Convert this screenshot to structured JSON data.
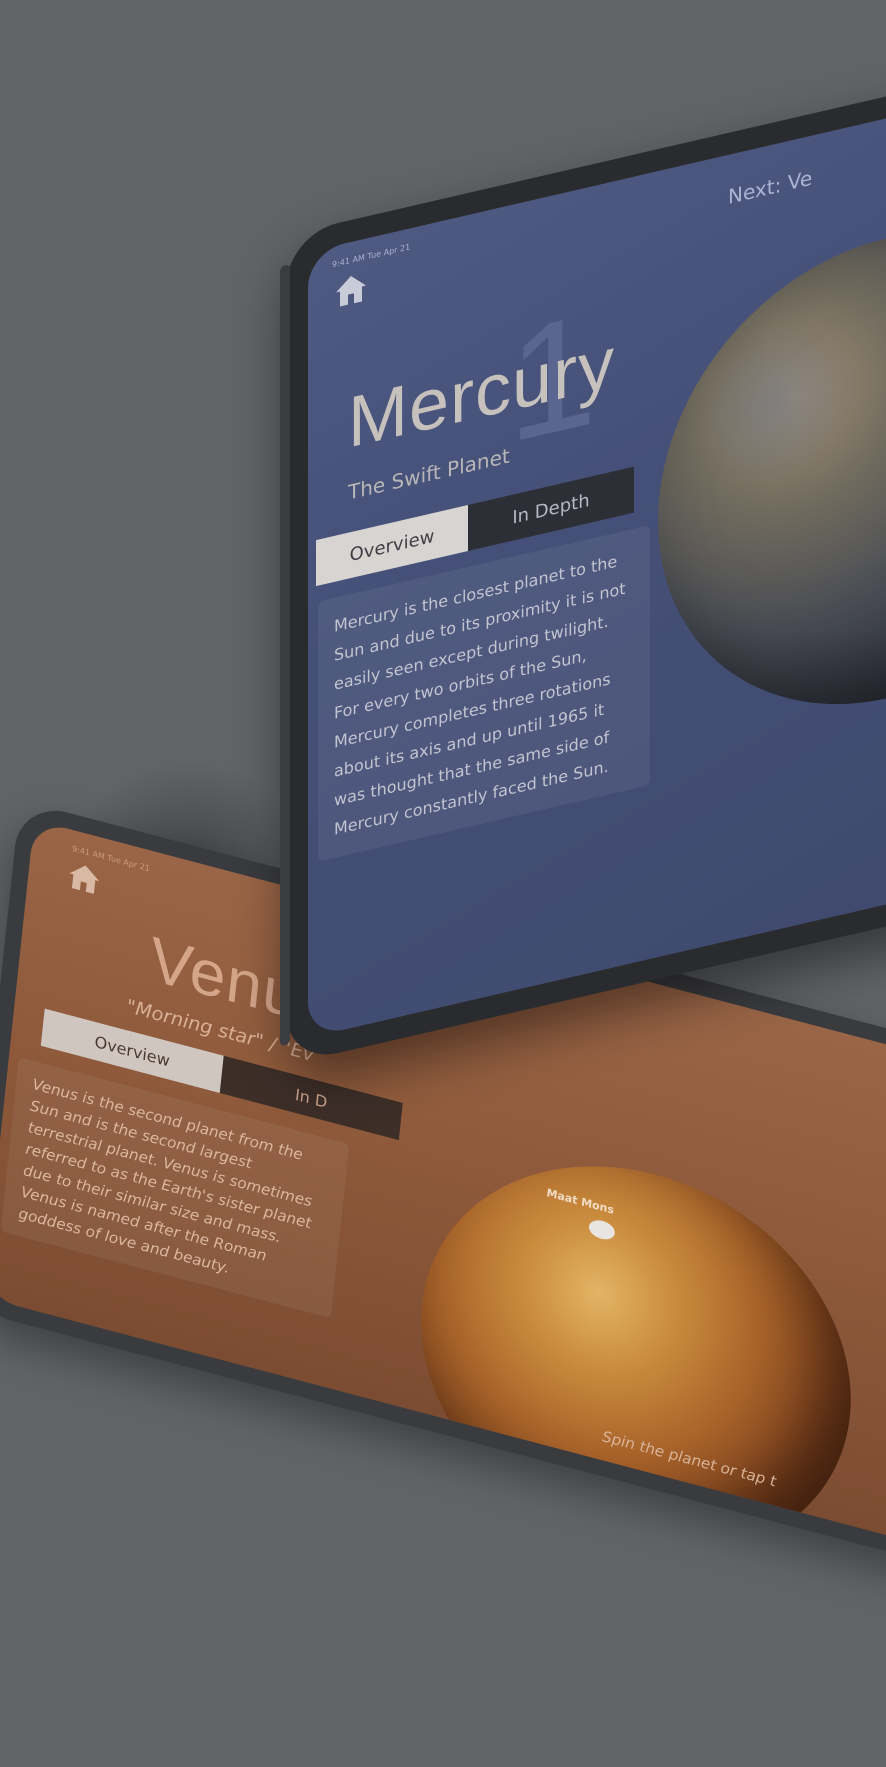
{
  "venus": {
    "status_bar": "9:41 AM  Tue Apr 21",
    "title": "Venus",
    "subtitle": "\"Morning star\" / \"Ev",
    "tabs": {
      "overview": "Overview",
      "in_depth": "In D"
    },
    "body": "Venus is the second planet from the Sun and is the second largest terrestrial planet. Venus is sometimes referred to as the Earth's sister planet due to their similar size and mass. Venus is named after the Roman goddess of love and beauty.",
    "pin_label": "Maat Mons",
    "hint": "Spin the planet or tap t",
    "colors": {
      "screen": "#9a6547",
      "planet": "#c98a3c"
    }
  },
  "mercury": {
    "status_bar": "9:41 AM  Tue Apr 21",
    "number": "1",
    "next": "Next: Ve",
    "title": "Mercury",
    "subtitle": "The Swift Planet",
    "tabs": {
      "overview": "Overview",
      "in_depth": "In Depth"
    },
    "body": "Mercury is the closest planet to the Sun and due to its proximity it is not easily seen except during twilight. For every two orbits of the Sun, Mercury completes three rotations about its axis and up until 1965 it was thought that the same side of Mercury constantly faced the Sun.",
    "colors": {
      "screen": "#4e5a82",
      "tab_active": "#d8d4d2",
      "tab_inactive": "#2d2f36"
    }
  },
  "icons": {
    "home": "home-icon"
  }
}
